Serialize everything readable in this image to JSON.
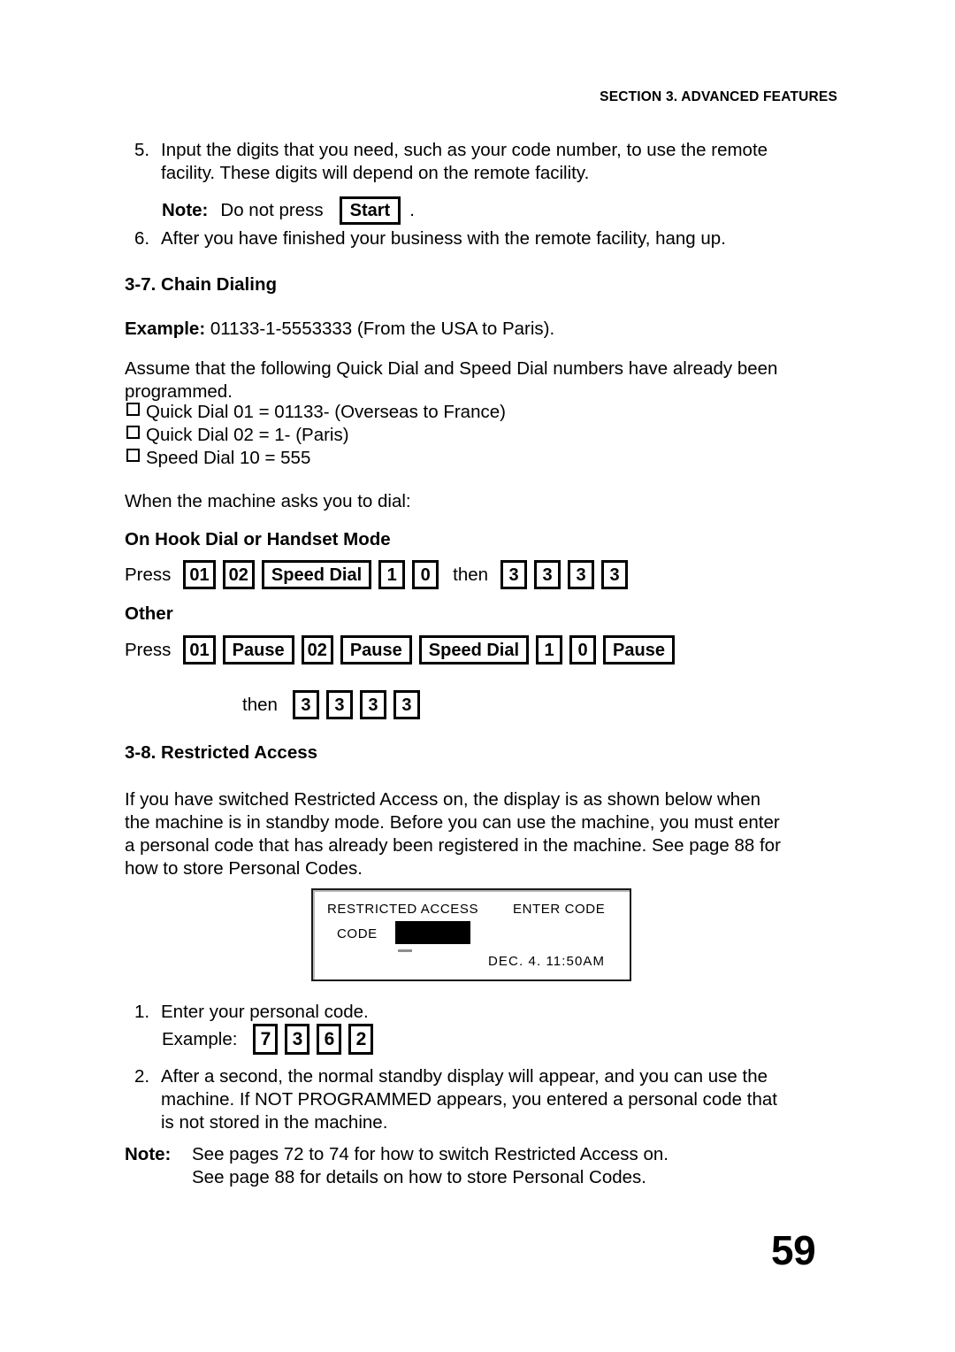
{
  "header": {
    "running_head": "SECTION 3. ADVANCED FEATURES"
  },
  "steps_top": [
    {
      "marker": "5.",
      "lines": [
        "Input the digits that you need, such as your code number,  to use the remote",
        "facility. These digits will depend on the remote facility."
      ]
    },
    {
      "marker": "6.",
      "lines": [
        "After you have finished your business with the remote facility, hang up."
      ]
    }
  ],
  "note_start": {
    "label": "Note:",
    "text_before": "Do not press",
    "key": "Start",
    "text_after": "."
  },
  "section_chain": {
    "heading": "3-7. Chain Dialing",
    "example_label": "Example:",
    "example_text": "01133-1-5553333 (From the USA to Paris).",
    "assume_lines": [
      "Assume that the following Quick Dial and Speed Dial numbers have already been",
      "programmed."
    ],
    "bullets": [
      "Quick Dial 01 = 01133- (Overseas to France)",
      "Quick Dial 02 = 1- (Paris)",
      "Speed Dial 10 = 555"
    ],
    "prompt": "When the machine asks you to dial:",
    "mode_onhook": {
      "title": "On Hook Dial or Handset Mode",
      "press_label": "Press",
      "keys": [
        "01",
        "02",
        "Speed Dial",
        "1",
        "0"
      ],
      "conj": "then",
      "digits": [
        "3",
        "3",
        "3",
        "3"
      ]
    },
    "mode_other": {
      "title": "Other",
      "press_label": "Press",
      "keys": [
        "01",
        "Pause",
        "02",
        "Pause",
        "Speed Dial",
        "1",
        "0",
        "Pause"
      ],
      "conj": "then",
      "digits": [
        "3",
        "3",
        "3",
        "3"
      ]
    }
  },
  "section_restricted": {
    "heading": "3-8. Restricted Access",
    "intro_lines": [
      "If you have switched Restricted Access on, the display is as shown below when",
      "the machine is in standby mode. Before you can use the machine, you must enter",
      "a personal code that has already been registered in the machine. See page   88 for",
      "how to store Personal Codes."
    ],
    "lcd": {
      "title_left": "RESTRICTED ACCESS",
      "title_right": "ENTER CODE",
      "code_label": "CODE",
      "code_value": "",
      "datetime": "DEC. 4. 11:50AM"
    },
    "step1": {
      "marker": "1.",
      "text": "Enter your personal code.",
      "example_label": "Example:",
      "code_digits": [
        "7",
        "3",
        "6",
        "2"
      ]
    },
    "step2": {
      "marker": "2.",
      "lines": [
        "After a second, the normal standby display will appear, and you can use the",
        "machine. If NOT PROGRAMMED  appears, you entered a personal code that",
        "is not stored in the machine."
      ]
    },
    "note": {
      "label": "Note:",
      "lines": [
        "See pages 72 to 74 for how to switch Restricted Access on.",
        "See page 88 for details on how to store Personal Codes."
      ]
    }
  },
  "footer": {
    "page_number": "59"
  }
}
